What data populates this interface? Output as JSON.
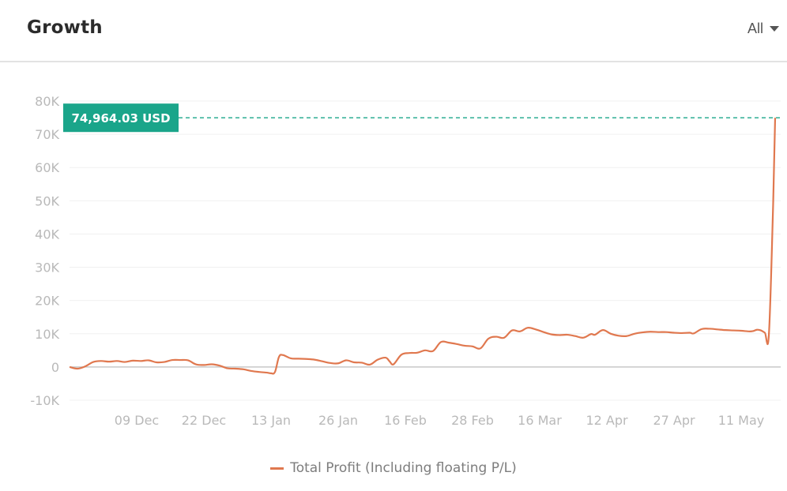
{
  "header": {
    "title": "Growth",
    "range_selector": {
      "selected": "All"
    }
  },
  "colors": {
    "line": "#e0784f",
    "badge": "#1aa58a",
    "dashed_line": "#1aa58a",
    "grid": "#f0f0f0",
    "zero_line": "#c8c8c8",
    "tick_text": "#b9b9b9"
  },
  "chart_data": {
    "type": "line",
    "title": "Growth",
    "xlabel": "",
    "ylabel": "",
    "ylim": [
      -10000,
      80000
    ],
    "yticks": [
      {
        "value": 80000,
        "label": "80K"
      },
      {
        "value": 70000,
        "label": "70K"
      },
      {
        "value": 60000,
        "label": "60K"
      },
      {
        "value": 50000,
        "label": "50K"
      },
      {
        "value": 40000,
        "label": "40K"
      },
      {
        "value": 30000,
        "label": "30K"
      },
      {
        "value": 20000,
        "label": "20K"
      },
      {
        "value": 10000,
        "label": "10K"
      },
      {
        "value": 0,
        "label": "0"
      },
      {
        "value": -10000,
        "label": "-10K"
      }
    ],
    "xlim": [
      0,
      180
    ],
    "xticks": [
      {
        "x": 17,
        "label": "09 Dec"
      },
      {
        "x": 34,
        "label": "22 Dec"
      },
      {
        "x": 51,
        "label": "13 Jan"
      },
      {
        "x": 68,
        "label": "26 Jan"
      },
      {
        "x": 85,
        "label": "16 Feb"
      },
      {
        "x": 102,
        "label": "28 Feb"
      },
      {
        "x": 119,
        "label": "16 Mar"
      },
      {
        "x": 136,
        "label": "12 Apr"
      },
      {
        "x": 153,
        "label": "27 Apr"
      },
      {
        "x": 170,
        "label": "11 May"
      }
    ],
    "grid": true,
    "legend": {
      "position": "bottom-center",
      "entries": [
        "Total Profit (Including floating P/L)"
      ]
    },
    "annotation": {
      "value": 74964.03,
      "label": "74,964.03 USD"
    },
    "series": [
      {
        "name": "Total Profit (Including floating P/L)",
        "points": [
          [
            0,
            0
          ],
          [
            2,
            -500
          ],
          [
            4,
            200
          ],
          [
            6,
            1500
          ],
          [
            8,
            1800
          ],
          [
            10,
            1600
          ],
          [
            12,
            1800
          ],
          [
            14,
            1500
          ],
          [
            16,
            1900
          ],
          [
            18,
            1800
          ],
          [
            20,
            2000
          ],
          [
            22,
            1400
          ],
          [
            24,
            1500
          ],
          [
            26,
            2100
          ],
          [
            28,
            2100
          ],
          [
            30,
            2000
          ],
          [
            32,
            800
          ],
          [
            34,
            600
          ],
          [
            36,
            800
          ],
          [
            38,
            400
          ],
          [
            40,
            -400
          ],
          [
            42,
            -500
          ],
          [
            44,
            -700
          ],
          [
            46,
            -1200
          ],
          [
            48,
            -1500
          ],
          [
            50,
            -1700
          ],
          [
            51,
            -1900
          ],
          [
            52,
            -1500
          ],
          [
            53,
            3000
          ],
          [
            54,
            3600
          ],
          [
            56,
            2600
          ],
          [
            58,
            2500
          ],
          [
            60,
            2400
          ],
          [
            62,
            2200
          ],
          [
            64,
            1700
          ],
          [
            66,
            1200
          ],
          [
            68,
            1100
          ],
          [
            70,
            2000
          ],
          [
            72,
            1400
          ],
          [
            74,
            1300
          ],
          [
            76,
            700
          ],
          [
            78,
            2200
          ],
          [
            80,
            2800
          ],
          [
            81,
            1700
          ],
          [
            82,
            800
          ],
          [
            84,
            3700
          ],
          [
            86,
            4200
          ],
          [
            88,
            4300
          ],
          [
            90,
            5000
          ],
          [
            92,
            4800
          ],
          [
            94,
            7500
          ],
          [
            96,
            7300
          ],
          [
            98,
            6900
          ],
          [
            100,
            6400
          ],
          [
            102,
            6200
          ],
          [
            104,
            5600
          ],
          [
            106,
            8500
          ],
          [
            108,
            9100
          ],
          [
            110,
            8800
          ],
          [
            112,
            11000
          ],
          [
            114,
            10700
          ],
          [
            116,
            11800
          ],
          [
            118,
            11300
          ],
          [
            120,
            10500
          ],
          [
            122,
            9800
          ],
          [
            124,
            9600
          ],
          [
            126,
            9700
          ],
          [
            128,
            9300
          ],
          [
            130,
            8800
          ],
          [
            132,
            9900
          ],
          [
            133,
            9700
          ],
          [
            135,
            11100
          ],
          [
            137,
            10000
          ],
          [
            139,
            9400
          ],
          [
            141,
            9300
          ],
          [
            143,
            10000
          ],
          [
            145,
            10400
          ],
          [
            147,
            10600
          ],
          [
            149,
            10500
          ],
          [
            151,
            10500
          ],
          [
            153,
            10300
          ],
          [
            155,
            10200
          ],
          [
            157,
            10300
          ],
          [
            158,
            10100
          ],
          [
            160,
            11400
          ],
          [
            162,
            11500
          ],
          [
            164,
            11300
          ],
          [
            166,
            11100
          ],
          [
            168,
            11000
          ],
          [
            170,
            10900
          ],
          [
            172,
            10700
          ],
          [
            173,
            10800
          ],
          [
            174,
            11200
          ],
          [
            175,
            11000
          ],
          [
            176,
            10300
          ],
          [
            177,
            9500
          ],
          [
            178,
            45000
          ],
          [
            178.6,
            74964.03
          ]
        ]
      }
    ]
  }
}
